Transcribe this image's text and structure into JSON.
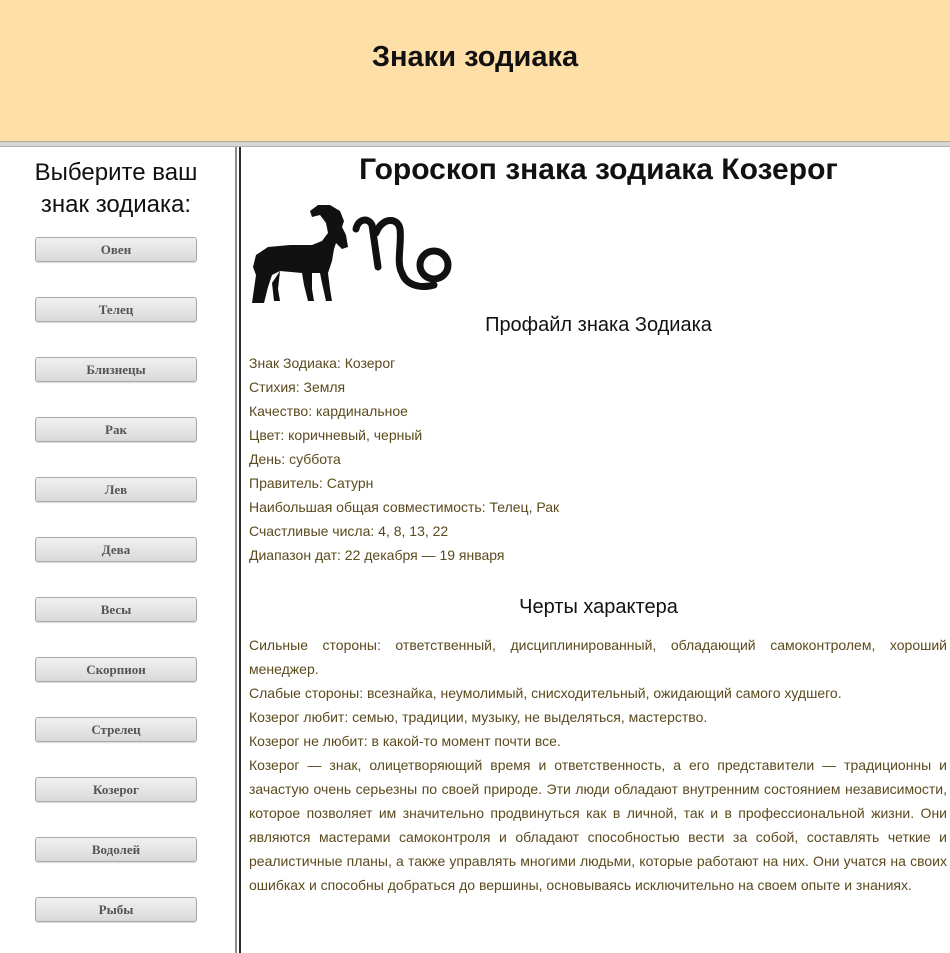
{
  "header": {
    "title": "Знаки зодиака"
  },
  "sidebar": {
    "heading_line1": "Выберите ваш",
    "heading_line2": "знак зодиака:",
    "signs": [
      "Овен",
      "Телец",
      "Близнецы",
      "Рак",
      "Лев",
      "Дева",
      "Весы",
      "Скорпион",
      "Стрелец",
      "Козерог",
      "Водолей",
      "Рыбы"
    ]
  },
  "main": {
    "title": "Гороскоп знака зодиака Козерог",
    "image": {
      "icon": "capricorn-goat-and-glyph"
    },
    "profile_heading": "Профайл знака Зодиака",
    "profile": [
      "Знак Зодиака: Козерог",
      "Стихия: Земля",
      "Качество: кардинальное",
      "Цвет: коричневый, черный",
      "День: суббота",
      "Правитель: Сатурн",
      "Наибольшая общая совместимость: Телец, Рак",
      "Счастливые числа: 4, 8, 13, 22",
      "Диапазон дат: 22 декабря — 19 января"
    ],
    "traits_heading": "Черты характера",
    "traits": {
      "strengths": "Сильные стороны: ответственный, дисциплинированный, обладающий самоконтролем, хороший менеджер.",
      "weaknesses": "Слабые стороны: всезнайка, неумолимый, снисходительный, ожидающий самого худшего.",
      "likes": "Козерог любит: семью, традиции, музыку, не выделяться, мастерство.",
      "dislikes": "Козерог не любит: в какой-то момент почти все.",
      "description": "Козерог — знак, олицетворяющий время и ответственность, а его представители — традиционны и зачастую очень серьезны по своей природе. Эти люди обладают внутренним состоянием независимости, которое позволяет им значительно продвинуться как в личной, так и в профессиональной жизни. Они являются мастерами самоконтроля и обладают способностью вести за собой, составлять четкие и реалистичные планы, а также управлять многими людьми, которые работают на них. Они учатся на своих ошибках и способны добраться до вершины, основываясь исключительно на своем опыте и знаниях."
    }
  },
  "colors": {
    "header_bg": "#ffdfa8",
    "body_text": "#5b4a1e",
    "button_text": "#555555"
  }
}
